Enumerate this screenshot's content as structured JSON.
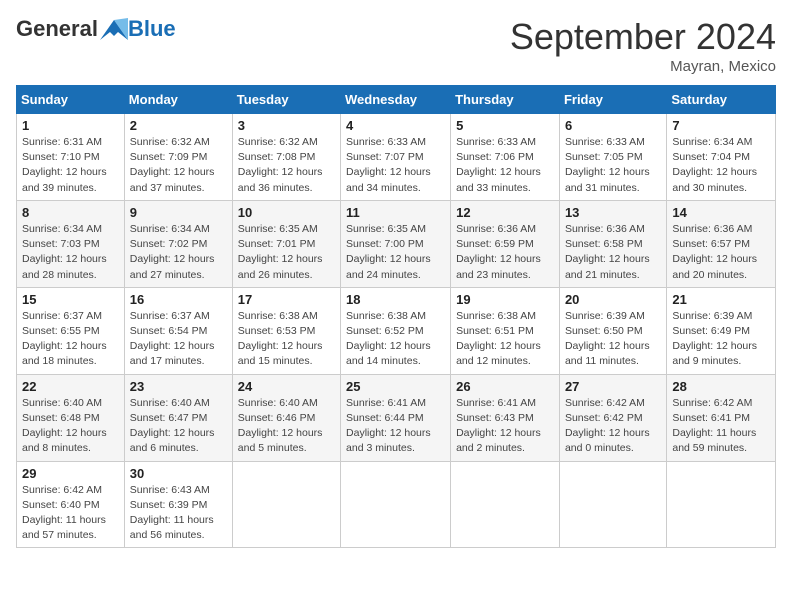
{
  "header": {
    "logo_general": "General",
    "logo_blue": "Blue",
    "month_title": "September 2024",
    "location": "Mayran, Mexico"
  },
  "days_of_week": [
    "Sunday",
    "Monday",
    "Tuesday",
    "Wednesday",
    "Thursday",
    "Friday",
    "Saturday"
  ],
  "weeks": [
    [
      {
        "day": "1",
        "info": "Sunrise: 6:31 AM\nSunset: 7:10 PM\nDaylight: 12 hours\nand 39 minutes."
      },
      {
        "day": "2",
        "info": "Sunrise: 6:32 AM\nSunset: 7:09 PM\nDaylight: 12 hours\nand 37 minutes."
      },
      {
        "day": "3",
        "info": "Sunrise: 6:32 AM\nSunset: 7:08 PM\nDaylight: 12 hours\nand 36 minutes."
      },
      {
        "day": "4",
        "info": "Sunrise: 6:33 AM\nSunset: 7:07 PM\nDaylight: 12 hours\nand 34 minutes."
      },
      {
        "day": "5",
        "info": "Sunrise: 6:33 AM\nSunset: 7:06 PM\nDaylight: 12 hours\nand 33 minutes."
      },
      {
        "day": "6",
        "info": "Sunrise: 6:33 AM\nSunset: 7:05 PM\nDaylight: 12 hours\nand 31 minutes."
      },
      {
        "day": "7",
        "info": "Sunrise: 6:34 AM\nSunset: 7:04 PM\nDaylight: 12 hours\nand 30 minutes."
      }
    ],
    [
      {
        "day": "8",
        "info": "Sunrise: 6:34 AM\nSunset: 7:03 PM\nDaylight: 12 hours\nand 28 minutes."
      },
      {
        "day": "9",
        "info": "Sunrise: 6:34 AM\nSunset: 7:02 PM\nDaylight: 12 hours\nand 27 minutes."
      },
      {
        "day": "10",
        "info": "Sunrise: 6:35 AM\nSunset: 7:01 PM\nDaylight: 12 hours\nand 26 minutes."
      },
      {
        "day": "11",
        "info": "Sunrise: 6:35 AM\nSunset: 7:00 PM\nDaylight: 12 hours\nand 24 minutes."
      },
      {
        "day": "12",
        "info": "Sunrise: 6:36 AM\nSunset: 6:59 PM\nDaylight: 12 hours\nand 23 minutes."
      },
      {
        "day": "13",
        "info": "Sunrise: 6:36 AM\nSunset: 6:58 PM\nDaylight: 12 hours\nand 21 minutes."
      },
      {
        "day": "14",
        "info": "Sunrise: 6:36 AM\nSunset: 6:57 PM\nDaylight: 12 hours\nand 20 minutes."
      }
    ],
    [
      {
        "day": "15",
        "info": "Sunrise: 6:37 AM\nSunset: 6:55 PM\nDaylight: 12 hours\nand 18 minutes."
      },
      {
        "day": "16",
        "info": "Sunrise: 6:37 AM\nSunset: 6:54 PM\nDaylight: 12 hours\nand 17 minutes."
      },
      {
        "day": "17",
        "info": "Sunrise: 6:38 AM\nSunset: 6:53 PM\nDaylight: 12 hours\nand 15 minutes."
      },
      {
        "day": "18",
        "info": "Sunrise: 6:38 AM\nSunset: 6:52 PM\nDaylight: 12 hours\nand 14 minutes."
      },
      {
        "day": "19",
        "info": "Sunrise: 6:38 AM\nSunset: 6:51 PM\nDaylight: 12 hours\nand 12 minutes."
      },
      {
        "day": "20",
        "info": "Sunrise: 6:39 AM\nSunset: 6:50 PM\nDaylight: 12 hours\nand 11 minutes."
      },
      {
        "day": "21",
        "info": "Sunrise: 6:39 AM\nSunset: 6:49 PM\nDaylight: 12 hours\nand 9 minutes."
      }
    ],
    [
      {
        "day": "22",
        "info": "Sunrise: 6:40 AM\nSunset: 6:48 PM\nDaylight: 12 hours\nand 8 minutes."
      },
      {
        "day": "23",
        "info": "Sunrise: 6:40 AM\nSunset: 6:47 PM\nDaylight: 12 hours\nand 6 minutes."
      },
      {
        "day": "24",
        "info": "Sunrise: 6:40 AM\nSunset: 6:46 PM\nDaylight: 12 hours\nand 5 minutes."
      },
      {
        "day": "25",
        "info": "Sunrise: 6:41 AM\nSunset: 6:44 PM\nDaylight: 12 hours\nand 3 minutes."
      },
      {
        "day": "26",
        "info": "Sunrise: 6:41 AM\nSunset: 6:43 PM\nDaylight: 12 hours\nand 2 minutes."
      },
      {
        "day": "27",
        "info": "Sunrise: 6:42 AM\nSunset: 6:42 PM\nDaylight: 12 hours\nand 0 minutes."
      },
      {
        "day": "28",
        "info": "Sunrise: 6:42 AM\nSunset: 6:41 PM\nDaylight: 11 hours\nand 59 minutes."
      }
    ],
    [
      {
        "day": "29",
        "info": "Sunrise: 6:42 AM\nSunset: 6:40 PM\nDaylight: 11 hours\nand 57 minutes."
      },
      {
        "day": "30",
        "info": "Sunrise: 6:43 AM\nSunset: 6:39 PM\nDaylight: 11 hours\nand 56 minutes."
      },
      {
        "day": "",
        "info": ""
      },
      {
        "day": "",
        "info": ""
      },
      {
        "day": "",
        "info": ""
      },
      {
        "day": "",
        "info": ""
      },
      {
        "day": "",
        "info": ""
      }
    ]
  ]
}
